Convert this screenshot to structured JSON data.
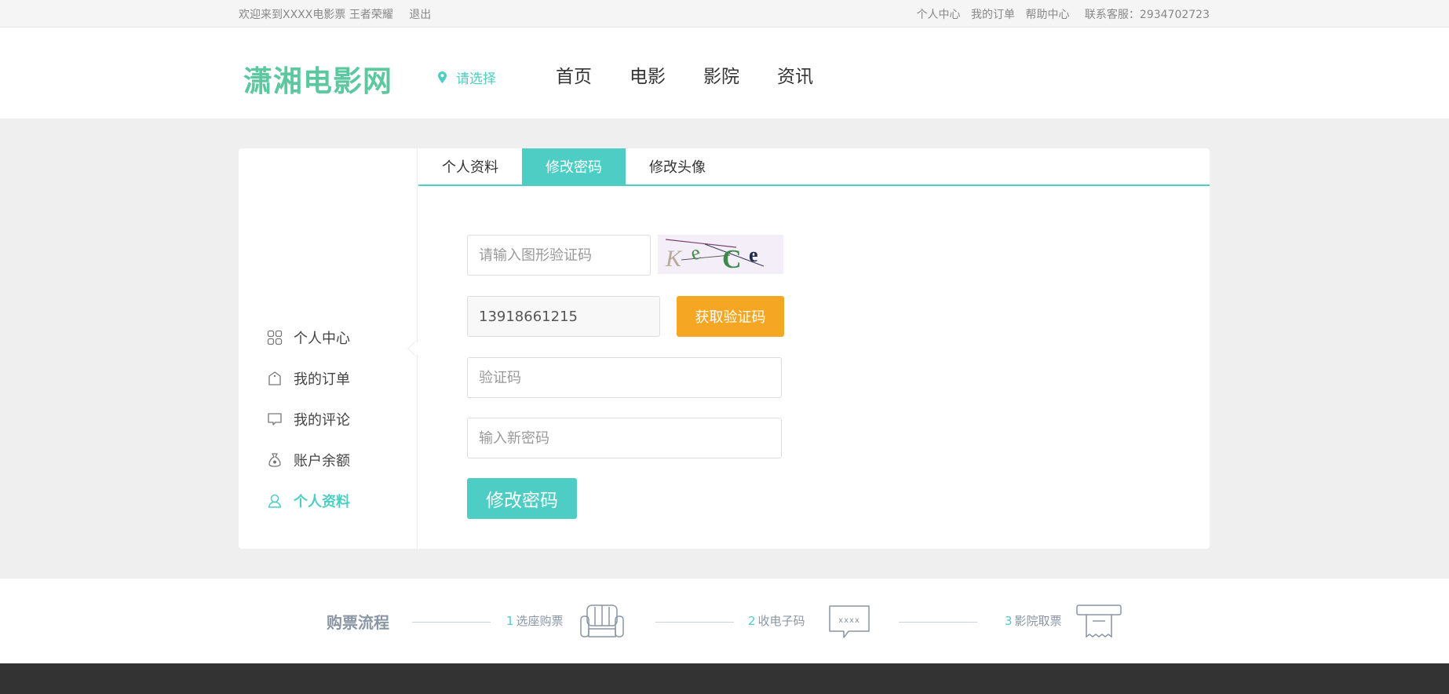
{
  "topbar": {
    "welcome": "欢迎来到XXXX电影票 王者荣耀",
    "logout": "退出",
    "links": [
      "个人中心",
      "我的订单",
      "帮助中心"
    ],
    "service": "联系客服：2934702723"
  },
  "header": {
    "logo": "潇湘电影网",
    "city": "请选择",
    "nav": [
      "首页",
      "电影",
      "影院",
      "资讯"
    ]
  },
  "sidebar": {
    "items": [
      {
        "label": "个人中心",
        "icon": "grid-icon"
      },
      {
        "label": "我的订单",
        "icon": "bag-icon"
      },
      {
        "label": "我的评论",
        "icon": "comment-icon"
      },
      {
        "label": "账户余额",
        "icon": "money-bag-icon"
      },
      {
        "label": "个人资料",
        "icon": "user-icon",
        "active": true
      }
    ]
  },
  "tabs": [
    {
      "label": "个人资料"
    },
    {
      "label": "修改密码",
      "active": true
    },
    {
      "label": "修改头像"
    }
  ],
  "form": {
    "captcha_placeholder": "请输入图形验证码",
    "captcha_text": "KeCe",
    "phone_value": "13918661215",
    "get_code_label": "获取验证码",
    "code_placeholder": "验证码",
    "new_password_placeholder": "输入新密码",
    "submit_label": "修改密码"
  },
  "process": {
    "title": "购票流程",
    "steps": [
      {
        "num": "1",
        "label": "选座购票"
      },
      {
        "num": "2",
        "label": "收电子码"
      },
      {
        "num": "3",
        "label": "影院取票"
      }
    ],
    "code_mask": "xxxx"
  },
  "colors": {
    "accent": "#4ecdc4",
    "logo": "#5dc7a0",
    "orange": "#f5a623",
    "footer": "#333333"
  }
}
